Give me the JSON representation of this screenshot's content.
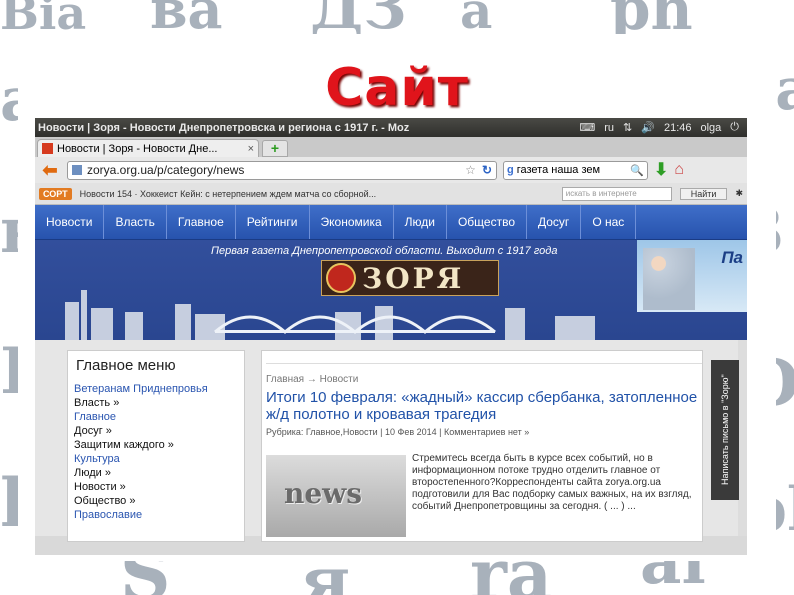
{
  "slide": {
    "title": "Сайт"
  },
  "decor": {
    "letters": [
      "Bia",
      "ва",
      "ДЗ",
      "а",
      "ph",
      "а",
      "ва",
      "ва",
      "3",
      "В",
      "Dа",
      "l",
      "S",
      "я",
      "ra",
      "al",
      "ph"
    ]
  },
  "system_bar": {
    "window_title": "Новости | Зоря - Новости Днепропетровска и региона с 1917 г. - Moz",
    "tray": {
      "lang": "ru",
      "time": "21:46",
      "user": "olga"
    }
  },
  "tab": {
    "label": "Новости | Зоря - Новости Дне...",
    "close": "×",
    "new_tab": "+"
  },
  "address_bar": {
    "url": "zorya.org.ua/p/category/news",
    "star": "☆",
    "reload": "↻"
  },
  "search_bar": {
    "engine": "g",
    "value": "газета наша зем"
  },
  "bookmarks": {
    "btn1": "СОРТ",
    "item1": "Новости 154 · Хоккеист Кейн: с нетерпением ждем матча со сборной...",
    "search_placeholder": "искать в интернете",
    "go": "Найти"
  },
  "site": {
    "menu": [
      "Новости",
      "Власть",
      "Главное",
      "Рейтинги",
      "Экономика",
      "Люди",
      "Общество",
      "Досуг",
      "О нас"
    ],
    "slogan": "Первая газета Днепропетровской области. Выходит с 1917 года",
    "logo_text": "ЗОРЯ",
    "ad_letter": "Па",
    "feedback_tab": "Написать письмо в \"Зорю\"",
    "sidebar": {
      "heading": "Главное меню",
      "items": [
        {
          "label": "Ветеранам Приднепровья",
          "tone": "lite"
        },
        {
          "label": "Власть »",
          "tone": "dark"
        },
        {
          "label": "Главное",
          "tone": "lite"
        },
        {
          "label": "Досуг »",
          "tone": "dark"
        },
        {
          "label": "Защитим каждого »",
          "tone": "dark"
        },
        {
          "label": "Культура",
          "tone": "lite"
        },
        {
          "label": "Люди »",
          "tone": "dark"
        },
        {
          "label": "Новости »",
          "tone": "dark"
        },
        {
          "label": "Общество »",
          "tone": "dark"
        },
        {
          "label": "Православие",
          "tone": "lite"
        }
      ]
    },
    "article": {
      "breadcrumb": "Главная → Новости",
      "headline": "Итоги 10 февраля: «жадный» кассир сбербанка, затопленное ж/д полотно и кровавая трагедия",
      "meta": "Рубрика: Главное,Новости | 10 Фев 2014 | Комментариев нет »",
      "thumb_text": "news",
      "excerpt": "Стремитесь всегда быть в курсе всех событий, но в информационном потоке трудно отделить главное от второстепенного?Корреспонденты сайта zorya.org.ua подготовили для Вас подборку самых важных, на их взгляд, событий Днепропетровщины за сегодня. ( ... ) ..."
    }
  }
}
